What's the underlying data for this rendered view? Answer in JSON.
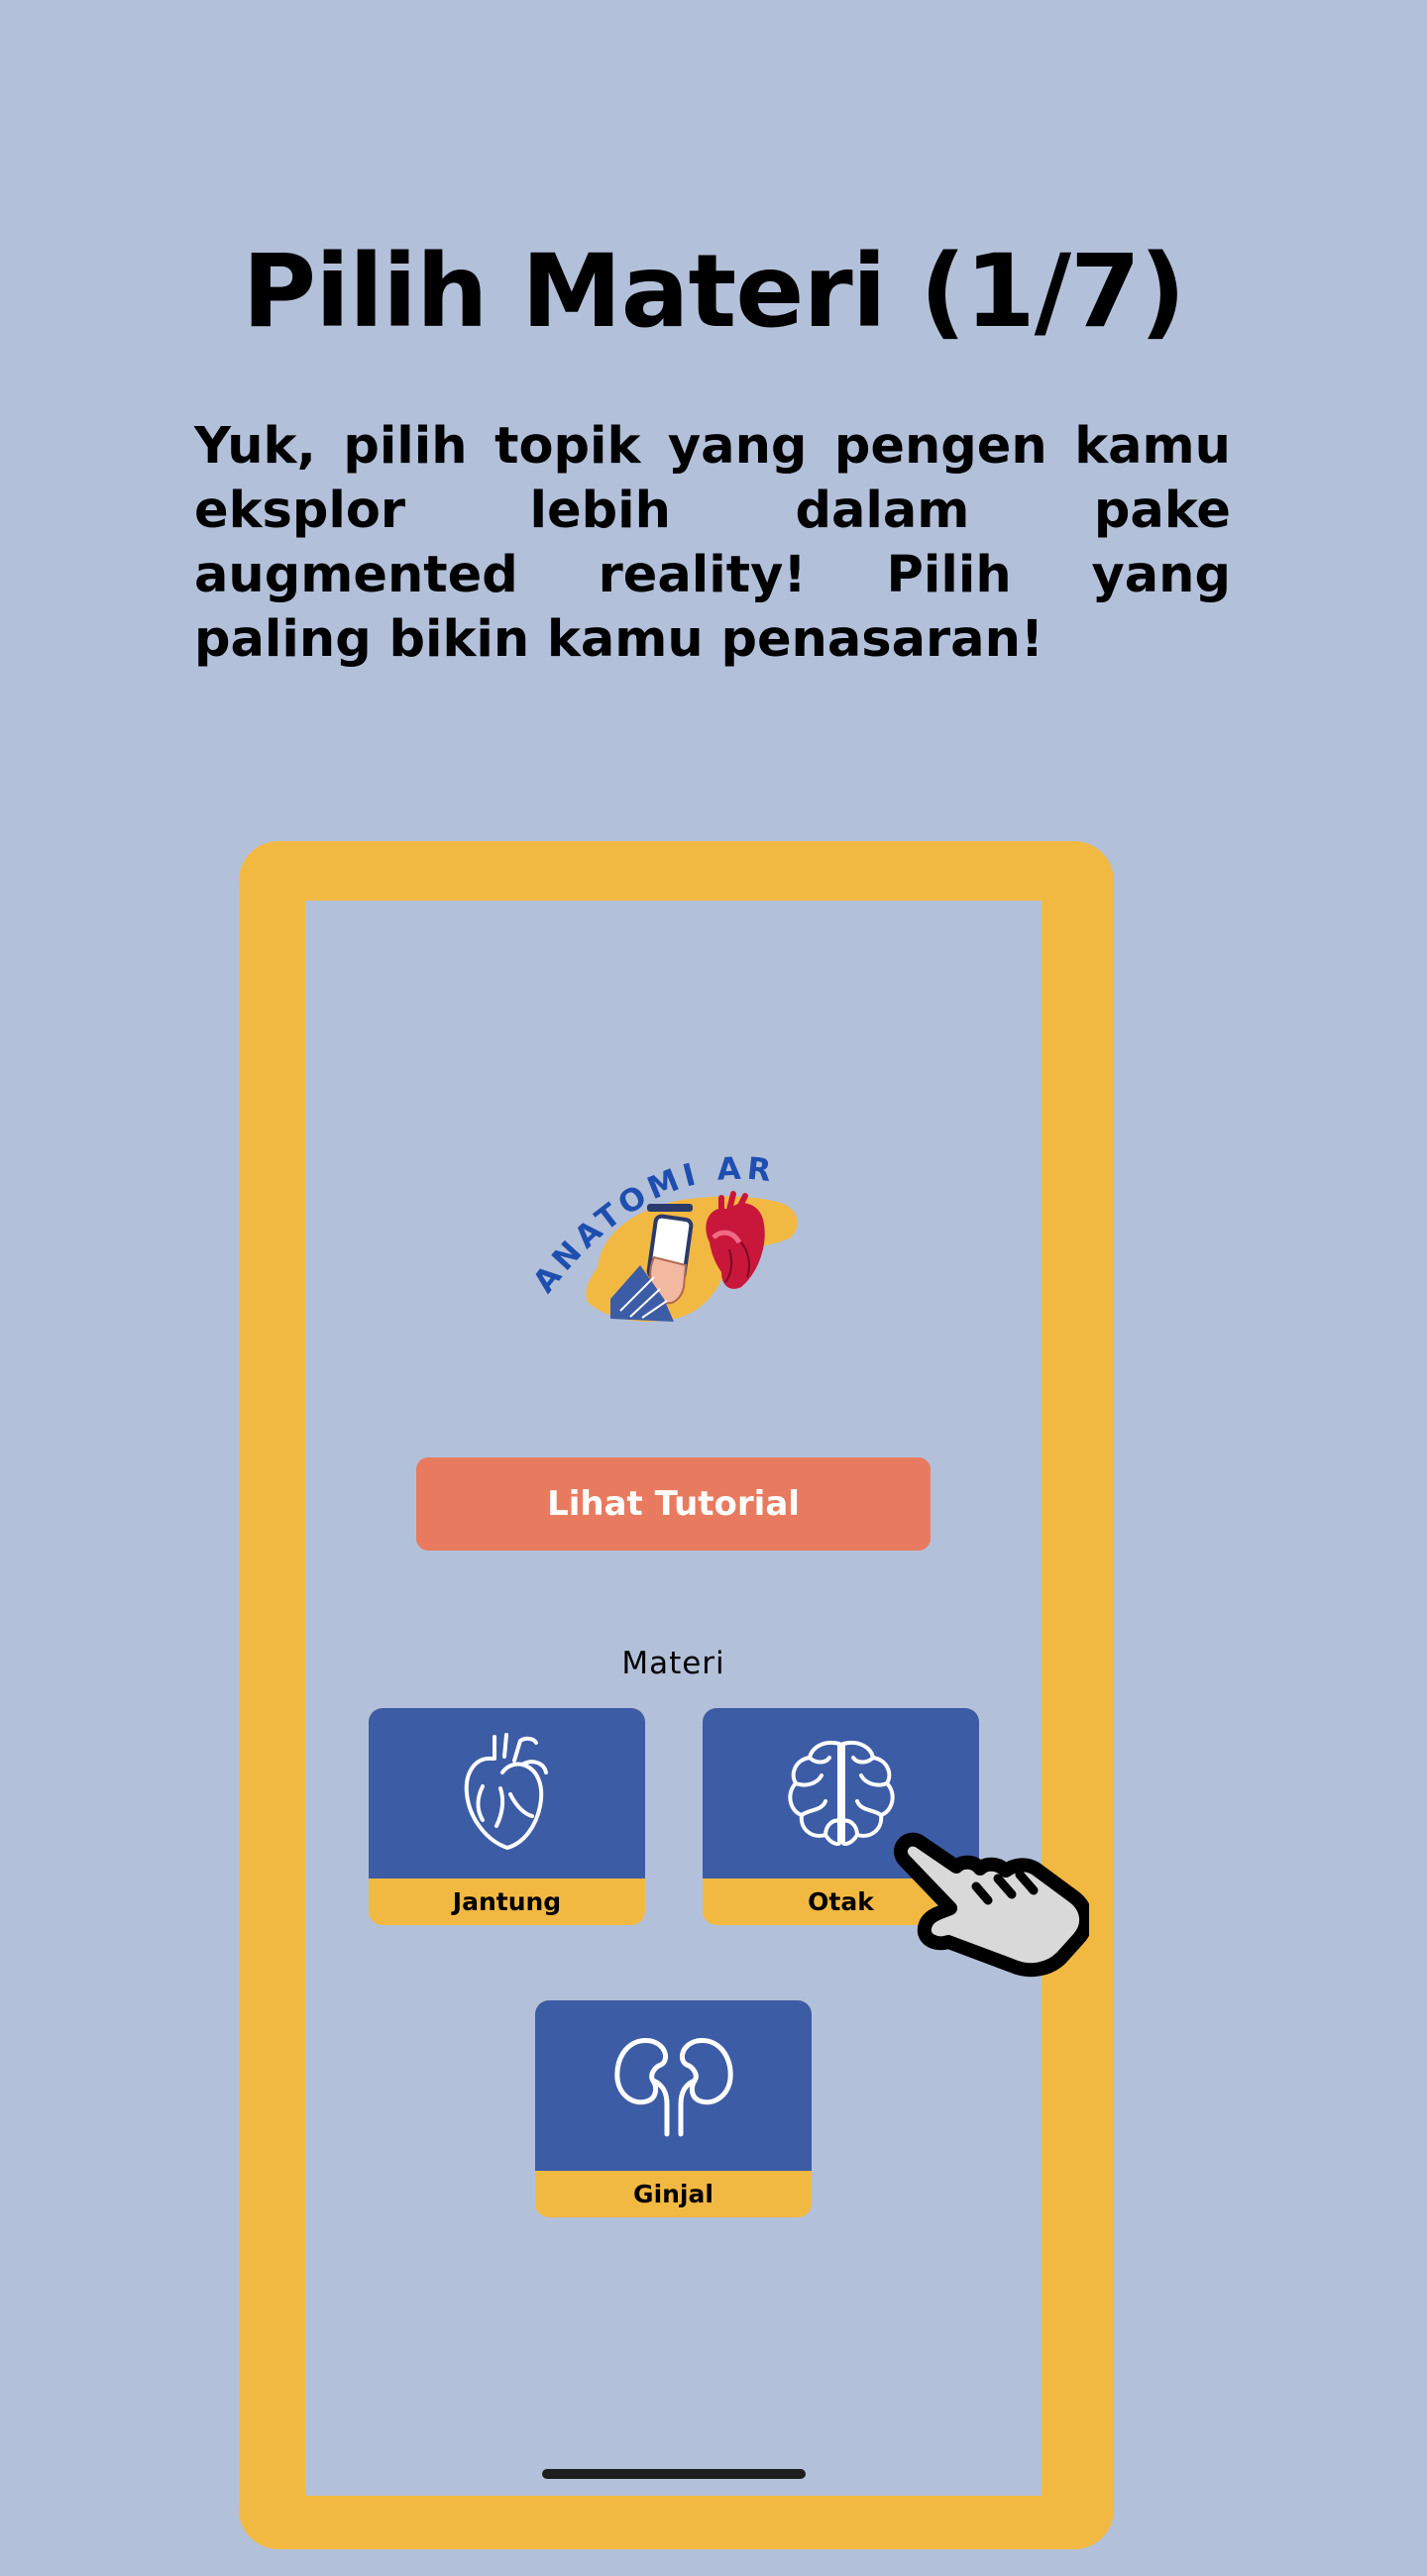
{
  "page": {
    "title": "Pilih Materi (1/7)",
    "intro": "Yuk, pilih topik yang pengen kamu eksplor lebih dalam pake augmented reality! Pilih yang paling bikin kamu penasaran!"
  },
  "app": {
    "logo_text": "ANATOMI AR",
    "tutorial_button": "Lihat Tutorial",
    "section_label": "Materi",
    "topics": [
      {
        "label": "Jantung",
        "icon": "heart-icon"
      },
      {
        "label": "Otak",
        "icon": "brain-icon"
      },
      {
        "label": "Ginjal",
        "icon": "kidney-icon"
      }
    ]
  },
  "colors": {
    "background": "#b3c0d9",
    "frame": "#f2b942",
    "card": "#3d5ca6",
    "button": "#e87b5f",
    "logo_text": "#1e4fb0"
  }
}
